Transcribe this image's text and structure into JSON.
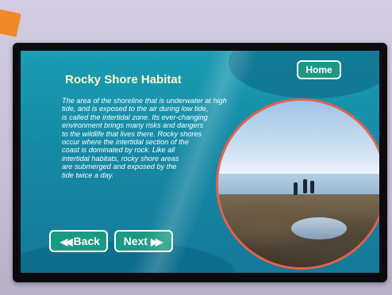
{
  "screen": {
    "title": "Rocky Shore Habitat",
    "paragraph_lines": [
      "The area of the shoreline that is underwater at high",
      "tide, and is exposed to the air during low tide,",
      "is called the intertidal zone. Its ever-changing",
      "environment brings many risks and dangers",
      "to the wildlife that lives there. Rocky shores",
      "occur where the intertidal section of the",
      "coast is dominated by rock. Like all",
      "intertidal habitats, rocky shore areas",
      "are submerged and exposed by the",
      "tide twice a day."
    ],
    "home_label": "Home",
    "back_label": "Back",
    "next_label": "Next",
    "back_arrow": "◀◀",
    "next_arrow": "▶▶"
  },
  "colors": {
    "screen_bg": "#1689a4",
    "button_bg": "#1a9a83",
    "title_color": "#fff6c8",
    "photo_border": "#e8604a",
    "accent_tab": "#f0892a"
  }
}
